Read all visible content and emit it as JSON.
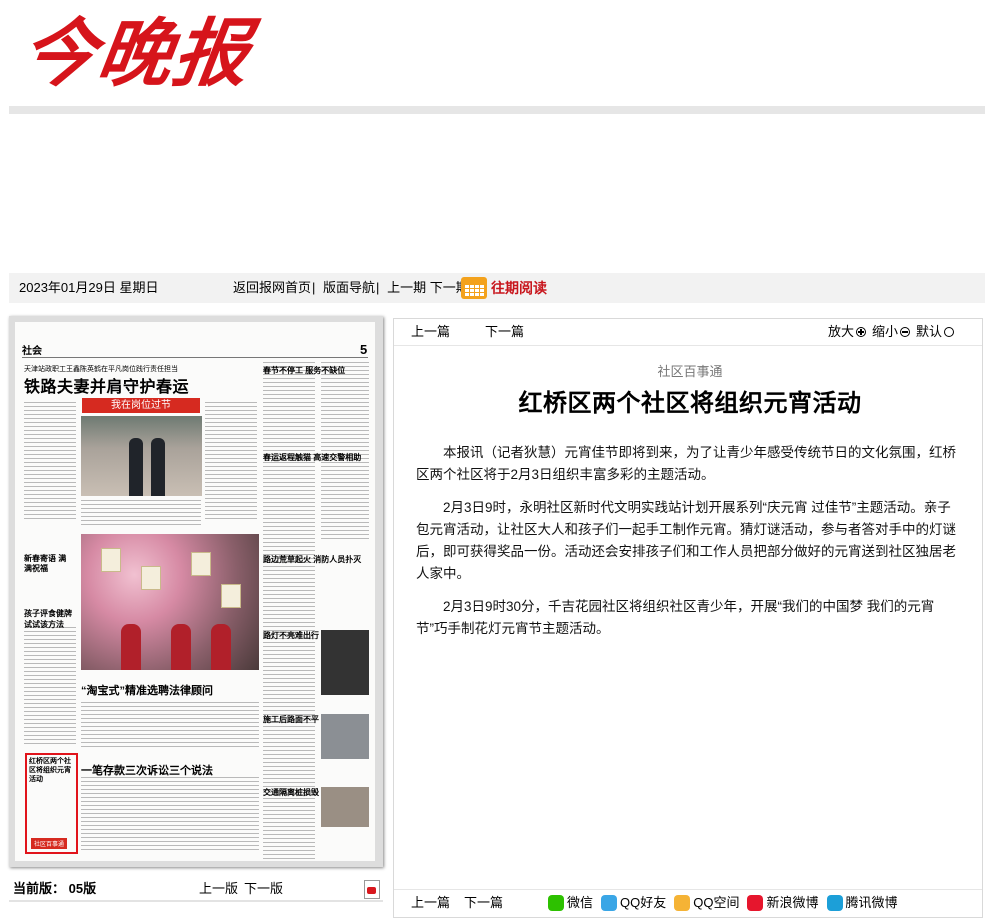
{
  "masthead": {
    "logo_text": "今晚报"
  },
  "nav": {
    "date": "2023年01月29日  星期日",
    "links": [
      "返回报网首页",
      "版面导航",
      "上一期",
      "下一期"
    ],
    "archive_label": "往期阅读"
  },
  "newspaper_page": {
    "section": "社会",
    "page_number": "5",
    "kicker": "天津站政职工王鑫陈英鹤在平凡岗位践行责任担当",
    "headline": "铁路夫妻并肩守护春运",
    "banner": "我在岗位过节",
    "box_spring": "新春寄语 满满祝福",
    "story_meal": "孩子评食健牌 试试该方法",
    "story_law": "“淘宝式”精准选聘法律顾问",
    "story_money": "一笔存款三次诉讼三个说法",
    "story_road": "路边荒草起火 消防人员扑灭",
    "story_lamp": "路灯不亮难出行",
    "story_work": "施工后路面不平",
    "story_traffic": "交通隔离桩损毁",
    "right_top": "春节不停工 服务不缺位",
    "right_mid": "春运返程触猫 高速交警相助",
    "highlight_title": "红桥区两个社区将组织元宵活动",
    "highlight_tag": "社区百事通"
  },
  "left_footer": {
    "current_label": "当前版：",
    "current_value": "05版",
    "prev_page": "上一版",
    "next_page": "下一版"
  },
  "article_toolbar": {
    "prev": "上一篇",
    "next": "下一篇",
    "zoom_in": "放大",
    "zoom_out": "缩小",
    "zoom_default": "默认"
  },
  "article": {
    "column": "社区百事通",
    "title": "红桥区两个社区将组织元宵活动",
    "paragraphs": [
      "本报讯（记者狄慧）元宵佳节即将到来，为了让青少年感受传统节日的文化氛围，红桥区两个社区将于2月3日组织丰富多彩的主题活动。",
      "2月3日9时，永明社区新时代文明实践站计划开展系列“庆元宵 过佳节”主题活动。亲子包元宵活动，让社区大人和孩子们一起手工制作元宵。猜灯谜活动，参与者答对手中的灯谜后，即可获得奖品一份。活动还会安排孩子们和工作人员把部分做好的元宵送到社区独居老人家中。",
      "2月3日9时30分，千吉花园社区将组织社区青少年，开展“我们的中国梦 我们的元宵节”巧手制花灯元宵节主题活动。"
    ]
  },
  "article_footer": {
    "prev": "上一篇",
    "next": "下一篇",
    "share": [
      {
        "label": "微信",
        "icon": "wechat-icon",
        "color": "#2dc100"
      },
      {
        "label": "QQ好友",
        "icon": "qq-icon",
        "color": "#3aa6e6"
      },
      {
        "label": "QQ空间",
        "icon": "qzone-icon",
        "color": "#f5b335"
      },
      {
        "label": "新浪微博",
        "icon": "weibo-icon",
        "color": "#e6162d"
      },
      {
        "label": "腾讯微博",
        "icon": "tencent-weibo-icon",
        "color": "#1c9fd8"
      }
    ]
  },
  "colors": {
    "brand_red": "#d6141b",
    "archive_orange": "#f3a21d"
  }
}
